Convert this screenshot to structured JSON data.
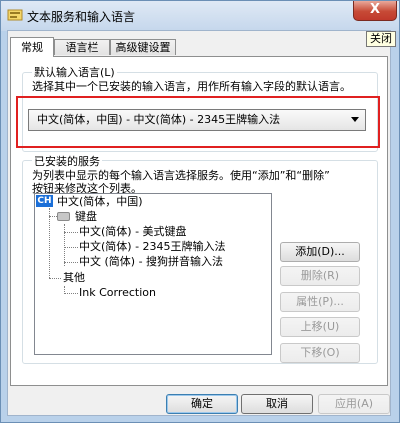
{
  "window": {
    "title": "文本服务和输入语言",
    "close_glyph": "X",
    "close_tooltip": "关闭"
  },
  "tabs": [
    {
      "label": "常规",
      "active": true
    },
    {
      "label": "语言栏",
      "active": false
    },
    {
      "label": "高级键设置",
      "active": false
    }
  ],
  "default_language": {
    "group_label": "默认输入语言(L)",
    "description": "选择其中一个已安装的输入语言，用作所有输入字段的默认语言。",
    "selected_value": "中文(简体，中国) - 中文(简体) - 2345王牌输入法"
  },
  "installed_services": {
    "group_label": "已安装的服务",
    "description_line1": "为列表中显示的每个输入语言选择服务。使用“添加”和“删除”",
    "description_line2": "按钮来修改这个列表。",
    "tree": {
      "language_badge": "CH",
      "language": "中文(简体，中国)",
      "keyboard_label": "键盘",
      "keyboards": [
        "中文(简体) - 美式键盘",
        "中文(简体) - 2345王牌输入法",
        "中文 (简体) - 搜狗拼音输入法"
      ],
      "other_label": "其他",
      "others": [
        "Ink Correction"
      ]
    },
    "buttons": {
      "add": "添加(D)...",
      "remove": "删除(R)",
      "properties": "属性(P)...",
      "move_up": "上移(U)",
      "move_down": "下移(O)"
    }
  },
  "footer": {
    "ok": "确定",
    "cancel": "取消",
    "apply": "应用(A)"
  },
  "colors": {
    "highlight_box": "#e02020",
    "language_badge": "#1b6fd8"
  }
}
